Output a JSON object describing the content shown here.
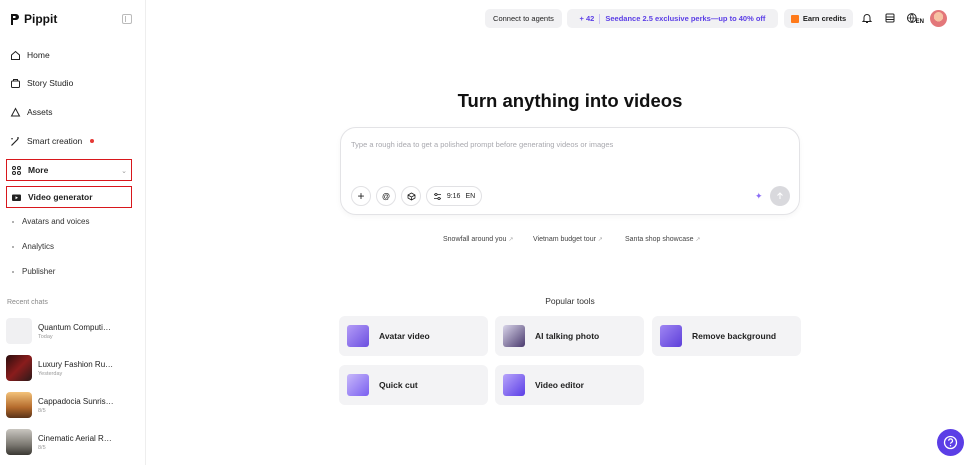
{
  "brand": {
    "name": "Pippit"
  },
  "sidebar": {
    "nav": [
      {
        "label": "Home",
        "icon": "home-icon"
      },
      {
        "label": "Story Studio",
        "icon": "story-icon"
      },
      {
        "label": "Assets",
        "icon": "cloud-icon"
      },
      {
        "label": "Smart creation",
        "icon": "magic-wand-icon"
      },
      {
        "label": "More",
        "icon": "grid-icon"
      },
      {
        "label": "Video generator",
        "icon": "video-icon"
      }
    ],
    "sub_items": [
      "Avatars and voices",
      "Analytics",
      "Publisher"
    ],
    "recent_label": "Recent chats",
    "recent_chats": [
      {
        "title": "Quantum Computi…",
        "subtitle": "Today"
      },
      {
        "title": "Luxury Fashion Ru…",
        "subtitle": "Yesterday"
      },
      {
        "title": "Cappadocia Sunris…",
        "subtitle": "8/5"
      },
      {
        "title": "Cinematic Aerial R…",
        "subtitle": "8/5"
      }
    ]
  },
  "topbar": {
    "connect_label": "Connect to agents",
    "credits_plus": "+ 42",
    "perks_label": "Seedance 2.5 exclusive perks—up to 40% off",
    "earn_label": "Earn credits",
    "lang_label": "EN"
  },
  "main": {
    "title": "Turn anything into videos",
    "prompt_placeholder": "Type a rough idea to get a polished prompt before generating videos or images",
    "ratio_label": "9:16",
    "lang_label": "EN",
    "suggestions": [
      "Snowfall around you",
      "Vietnam budget tour",
      "Santa shop showcase"
    ],
    "popular_label": "Popular tools",
    "tools": [
      "Avatar video",
      "AI talking photo",
      "Remove background",
      "Quick cut",
      "Video editor"
    ]
  },
  "colors": {
    "accent": "#5b3ee6",
    "highlight_border": "#d8171c",
    "notification_dot": "#e53935"
  }
}
